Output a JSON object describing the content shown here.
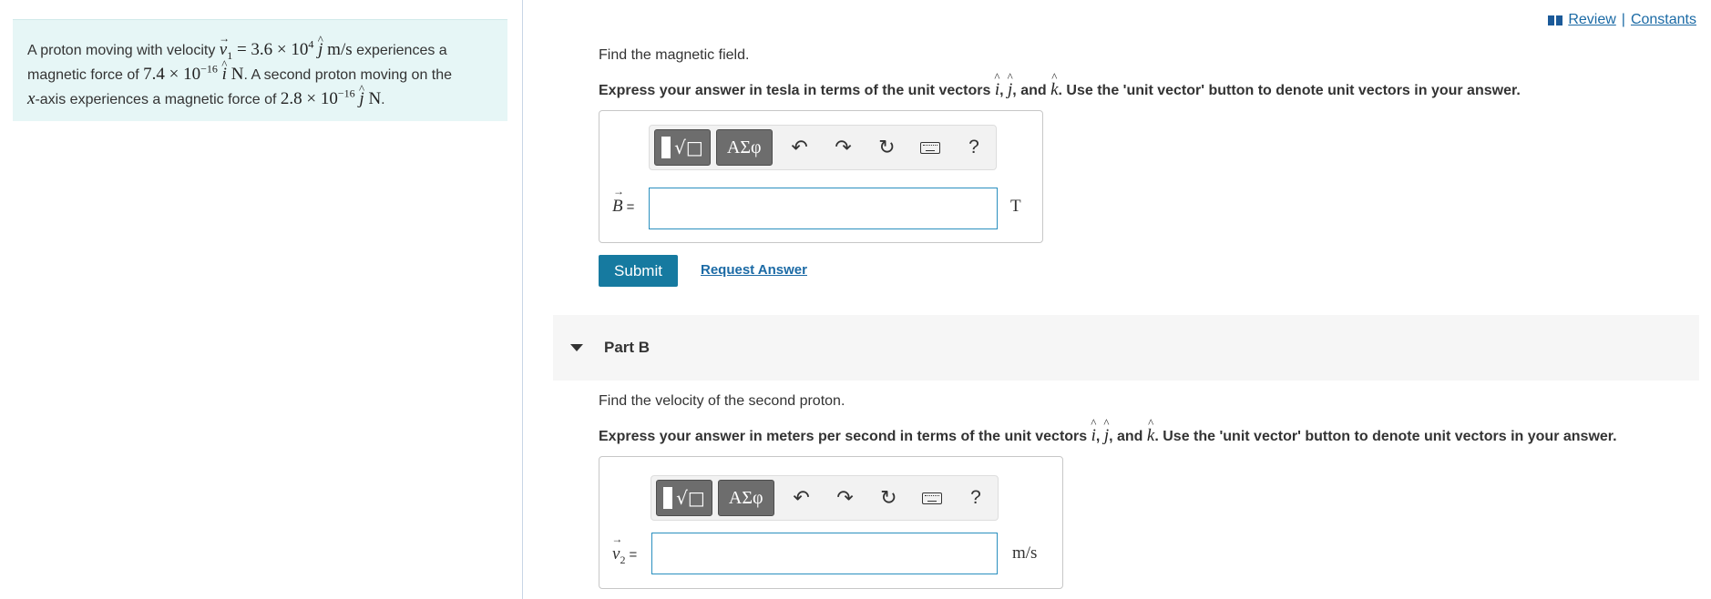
{
  "problem": {
    "line1_prefix": "A proton moving with velocity ",
    "v1_symbol": "v",
    "v1_sub": "1",
    "line1_eq": " = 3.6 × 10",
    "line1_exp": "4",
    "unit_j": "j",
    "line1_unit": " m/s",
    "line1_suffix": " experiences a",
    "line2_prefix": "magnetic force of ",
    "line2_value": "7.4 × 10",
    "line2_exp": "−16",
    "unit_i": "i",
    "line2_unit": " N",
    "line2_suffix": ". A second proton moving on the",
    "line3_axis": "x",
    "line3_mid": "-axis experiences a magnetic force of ",
    "line3_value": "2.8 × 10",
    "line3_exp": "−16",
    "line3_unit": " N",
    "line3_suffix": "."
  },
  "links": {
    "review": "Review",
    "separator": "|",
    "constants": "Constants"
  },
  "part_a": {
    "prompt": "Find the magnetic field.",
    "instruction_prefix": "Express your answer in tesla in terms of the unit vectors ",
    "instruction_suffix": ". Use the 'unit vector' button to denote unit vectors in your answer.",
    "var_symbol": "B",
    "eq": "=",
    "input_value": "",
    "unit": "T",
    "submit_label": "Submit",
    "request_label": "Request Answer"
  },
  "part_b": {
    "header": "Part B",
    "prompt": "Find the velocity of the second proton.",
    "instruction_prefix": "Express your answer in meters per second in terms of the unit vectors ",
    "instruction_suffix": ". Use the 'unit vector' button to denote unit vectors in your answer.",
    "var_symbol": "v",
    "var_sub": "2",
    "eq": "=",
    "input_value": "",
    "unit": "m/s"
  },
  "unit_vectors": {
    "i": "i",
    "j": "j",
    "k": "k",
    "comma": ",",
    "and": "and"
  },
  "toolbar": {
    "greek_label": "ΑΣφ",
    "help_label": "?",
    "undo_icon": "undo-icon",
    "redo_icon": "redo-icon",
    "reset_icon": "reset-icon",
    "keyboard_icon": "keyboard-icon"
  },
  "colors": {
    "panel_bg": "#e6f6f6",
    "submit_bg": "#167aa0",
    "link": "#1b6aa5",
    "input_border": "#2a8fbf"
  }
}
